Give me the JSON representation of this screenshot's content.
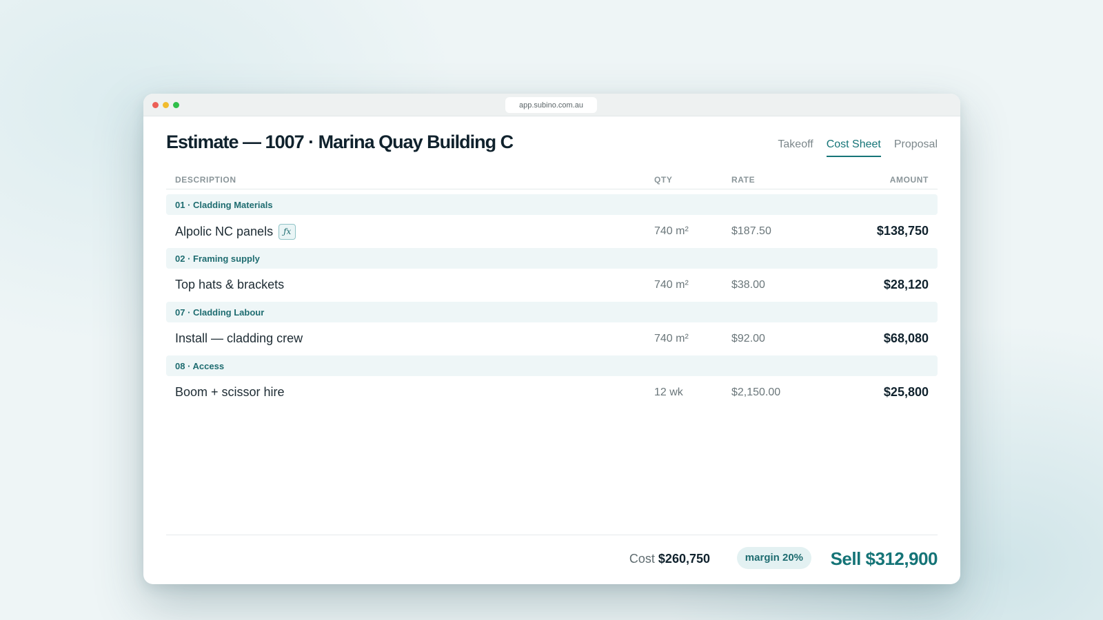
{
  "browser": {
    "url": "app.subino.com.au"
  },
  "header": {
    "title": "Estimate — 1007 · Marina Quay Building C",
    "tabs": [
      {
        "label": "Takeoff",
        "active": false
      },
      {
        "label": "Cost Sheet",
        "active": true
      },
      {
        "label": "Proposal",
        "active": false
      }
    ]
  },
  "table": {
    "columns": {
      "description": "DESCRIPTION",
      "qty": "QTY",
      "rate": "RATE",
      "amount": "AMOUNT"
    },
    "sections": [
      {
        "label": "01 · Cladding Materials",
        "item": {
          "description": "Alpolic NC panels",
          "formula_badge": "ƒx",
          "qty": "740 m²",
          "rate": "$187.50",
          "amount": "$138,750"
        }
      },
      {
        "label": "02 · Framing supply",
        "item": {
          "description": "Top hats & brackets",
          "qty": "740 m²",
          "rate": "$38.00",
          "amount": "$28,120"
        }
      },
      {
        "label": "07 · Cladding Labour",
        "item": {
          "description": "Install — cladding crew",
          "qty": "740 m²",
          "rate": "$92.00",
          "amount": "$68,080"
        }
      },
      {
        "label": "08 · Access",
        "item": {
          "description": "Boom + scissor hire",
          "qty": "12 wk",
          "rate": "$2,150.00",
          "amount": "$25,800"
        }
      }
    ]
  },
  "footer": {
    "cost_label": "Cost",
    "cost_value": "$260,750",
    "margin": "margin 20%",
    "sell": "Sell $312,900"
  },
  "colors": {
    "accent": "#157477",
    "section_bg": "#eef6f7",
    "title": "#10222d"
  }
}
